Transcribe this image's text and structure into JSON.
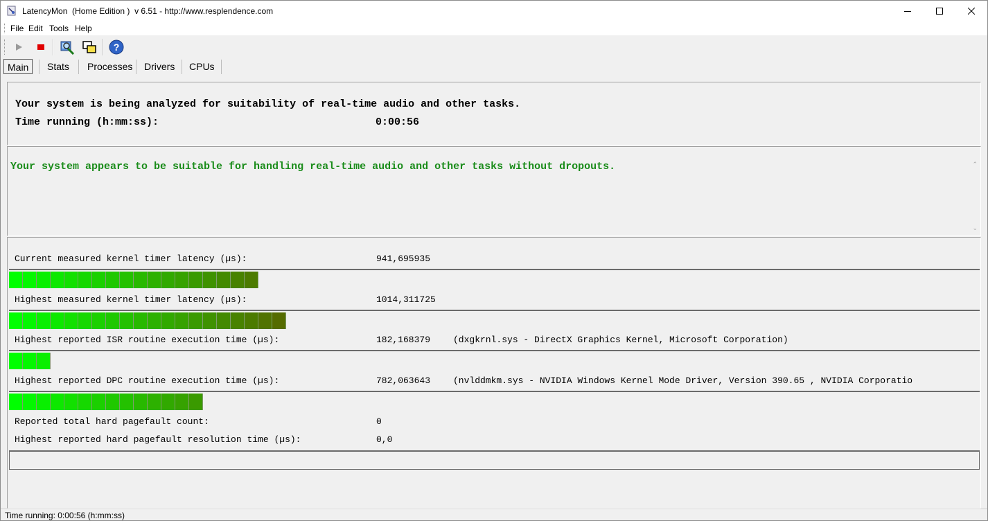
{
  "window": {
    "title": "LatencyMon  (Home Edition )  v 6.51 - http://www.resplendence.com",
    "controls": [
      "minimize-icon",
      "maximize-icon",
      "close-icon"
    ]
  },
  "menu": [
    "File",
    "Edit",
    "Tools",
    "Help"
  ],
  "toolbar": {
    "buttons": [
      "play-icon",
      "stop-icon",
      "analyze-icon",
      "windows-icon",
      "help-icon"
    ]
  },
  "tabs": [
    "Main",
    "Stats",
    "Processes",
    "Drivers",
    "CPUs"
  ],
  "status_panel": {
    "line1": "Your system is being analyzed for suitability of real-time audio and other tasks.",
    "time_label": "Time running (h:mm:ss):",
    "time_value": "0:00:56"
  },
  "verdict": {
    "text": "Your system appears to be suitable for handling real-time audio and other tasks without dropouts."
  },
  "metrics": [
    {
      "label": "Current measured kernel timer latency (µs):",
      "value": "941,695935",
      "detail": "",
      "bar_segments": 18
    },
    {
      "label": "Highest measured kernel timer latency (µs):",
      "value": "1014,311725",
      "detail": "",
      "bar_segments": 20
    },
    {
      "label": "Highest reported ISR routine execution time (µs):",
      "value": "182,168379",
      "detail": "(dxgkrnl.sys - DirectX Graphics Kernel, Microsoft Corporation)",
      "bar_segments": 3
    },
    {
      "label": "Highest reported DPC routine execution time (µs):",
      "value": "782,063643",
      "detail": "(nvlddmkm.sys - NVIDIA Windows Kernel Mode Driver, Version 390.65 , NVIDIA Corporatio",
      "bar_segments": 14
    }
  ],
  "pagefault": {
    "count_label": "Reported total hard pagefault count:",
    "count_value": "0",
    "time_label": "Highest reported hard pagefault resolution time (µs):",
    "time_value": "0,0",
    "bar_segments": 0
  },
  "statusbar": {
    "text": "Time running: 0:00:56  (h:mm:ss)"
  },
  "colors": {
    "bar_start": "#00ff00",
    "bar_end": "#556b00",
    "verdict_text": "#1a8c1a"
  }
}
